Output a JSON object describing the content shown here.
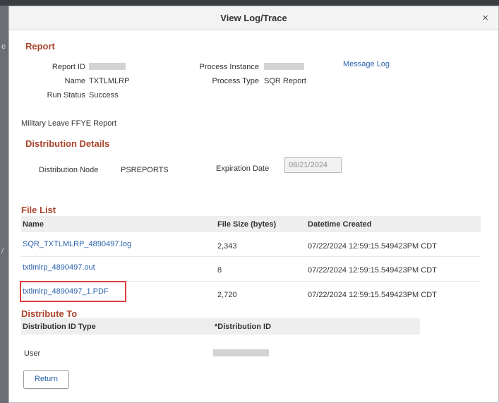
{
  "dialog": {
    "title": "View Log/Trace",
    "close_glyph": "×"
  },
  "report": {
    "section_title": "Report",
    "report_id_label": "Report ID",
    "name_label": "Name",
    "name_value": "TXTLMLRP",
    "run_status_label": "Run Status",
    "run_status_value": "Success",
    "process_instance_label": "Process Instance",
    "process_type_label": "Process Type",
    "process_type_value": "SQR Report",
    "message_log_link": "Message Log",
    "description": "Military Leave FFYE Report"
  },
  "distribution_details": {
    "section_title": "Distribution Details",
    "node_label": "Distribution Node",
    "node_value": "PSREPORTS",
    "expiration_label": "Expiration Date",
    "expiration_value": "08/21/2024"
  },
  "file_list": {
    "section_title": "File List",
    "columns": [
      "Name",
      "File Size (bytes)",
      "Datetime Created"
    ],
    "rows": [
      {
        "name": "SQR_TXTLMLRP_4890497.log",
        "size": "2,343",
        "created": "07/22/2024 12:59:15.549423PM CDT"
      },
      {
        "name": "txtlmlrp_4890497.out",
        "size": "8",
        "created": "07/22/2024 12:59:15.549423PM CDT"
      },
      {
        "name": "txtlmlrp_4890497_1.PDF",
        "size": "2,720",
        "created": "07/22/2024 12:59:15.549423PM CDT"
      }
    ],
    "highlight_color": "#e23d3d"
  },
  "distribute_to": {
    "section_title": "Distribute To",
    "columns": [
      "Distribution ID Type",
      "*Distribution ID"
    ],
    "rows": [
      {
        "type": "User"
      }
    ]
  },
  "buttons": {
    "return_label": "Return"
  },
  "colors": {
    "section_title": "#a9432b",
    "link": "#2a62ad"
  }
}
